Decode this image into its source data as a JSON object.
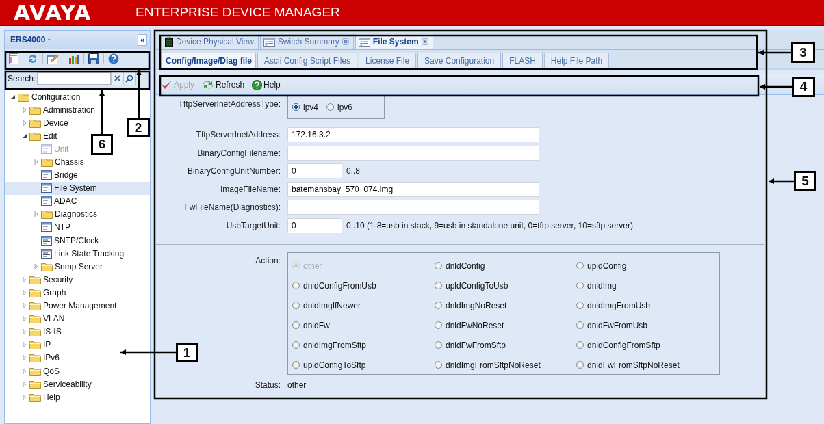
{
  "header": {
    "logo": "AVAYA",
    "title": "ENTERPRISE DEVICE MANAGER"
  },
  "sidebar": {
    "title": "ERS4000 -",
    "collapse": "«",
    "tools": [
      {
        "kind": "form"
      },
      {
        "kind": "refresh"
      },
      {
        "kind": "edit"
      },
      {
        "kind": "chart"
      },
      {
        "kind": "save"
      },
      {
        "kind": "help"
      }
    ],
    "search": {
      "label": "Search:"
    },
    "tree": [
      {
        "label": "Configuration",
        "kind": "folder",
        "expanded": true,
        "selected": false,
        "disabled": false,
        "children": [
          {
            "label": "Administration",
            "kind": "folder",
            "expanded": false,
            "selected": false,
            "disabled": false
          },
          {
            "label": "Device",
            "kind": "folder",
            "expanded": false,
            "selected": false,
            "disabled": false
          },
          {
            "label": "Edit",
            "kind": "folder",
            "expanded": true,
            "selected": false,
            "disabled": false,
            "children": [
              {
                "label": "Unit",
                "kind": "page",
                "selected": false,
                "disabled": true
              },
              {
                "label": "Chassis",
                "kind": "folder",
                "expanded": false,
                "selected": false,
                "disabled": false
              },
              {
                "label": "Bridge",
                "kind": "page",
                "selected": false,
                "disabled": false
              },
              {
                "label": "File System",
                "kind": "page",
                "selected": true,
                "disabled": false
              },
              {
                "label": "ADAC",
                "kind": "page",
                "selected": false,
                "disabled": false
              },
              {
                "label": "Diagnostics",
                "kind": "folder",
                "expanded": false,
                "selected": false,
                "disabled": false
              },
              {
                "label": "NTP",
                "kind": "page",
                "selected": false,
                "disabled": false
              },
              {
                "label": "SNTP/Clock",
                "kind": "page",
                "selected": false,
                "disabled": false
              },
              {
                "label": "Link State Tracking",
                "kind": "page",
                "selected": false,
                "disabled": false
              },
              {
                "label": "Snmp Server",
                "kind": "folder",
                "expanded": false,
                "selected": false,
                "disabled": false
              }
            ]
          },
          {
            "label": "Security",
            "kind": "folder",
            "expanded": false,
            "selected": false,
            "disabled": false
          },
          {
            "label": "Graph",
            "kind": "folder",
            "expanded": false,
            "selected": false,
            "disabled": false
          },
          {
            "label": "Power Management",
            "kind": "folder",
            "expanded": false,
            "selected": false,
            "disabled": false
          },
          {
            "label": "VLAN",
            "kind": "folder",
            "expanded": false,
            "selected": false,
            "disabled": false
          },
          {
            "label": "IS-IS",
            "kind": "folder",
            "expanded": false,
            "selected": false,
            "disabled": false
          },
          {
            "label": "IP",
            "kind": "folder",
            "expanded": false,
            "selected": false,
            "disabled": false
          },
          {
            "label": "IPv6",
            "kind": "folder",
            "expanded": false,
            "selected": false,
            "disabled": false
          },
          {
            "label": "QoS",
            "kind": "folder",
            "expanded": false,
            "selected": false,
            "disabled": false
          },
          {
            "label": "Serviceability",
            "kind": "folder",
            "expanded": false,
            "selected": false,
            "disabled": false
          },
          {
            "label": "Help",
            "kind": "folder",
            "expanded": false,
            "selected": false,
            "disabled": false
          }
        ]
      }
    ]
  },
  "tabs": [
    {
      "label": "Device Physical View",
      "kind": "device",
      "selected": false,
      "closable": false
    },
    {
      "label": "Switch Summary",
      "kind": "table",
      "selected": false,
      "closable": true
    },
    {
      "label": "File System",
      "kind": "table",
      "selected": true,
      "closable": true
    }
  ],
  "subtabs": [
    {
      "label": "Config/Image/Diag file",
      "selected": true
    },
    {
      "label": "Ascii Config Script Files",
      "selected": false
    },
    {
      "label": "License File",
      "selected": false
    },
    {
      "label": "Save Configuration",
      "selected": false
    },
    {
      "label": "FLASH",
      "selected": false
    },
    {
      "label": "Help File Path",
      "selected": false
    }
  ],
  "toolbar": [
    {
      "label": "Apply",
      "kind": "apply",
      "disabled": true
    },
    {
      "label": "Refresh",
      "kind": "refresh",
      "disabled": false
    },
    {
      "label": "Help",
      "kind": "help",
      "disabled": false
    }
  ],
  "form": [
    {
      "label": "TftpServerInetAddressType:",
      "kind": "radio",
      "options": [
        {
          "label": "ipv4",
          "selected": true
        },
        {
          "label": "ipv6",
          "selected": false
        }
      ]
    },
    {
      "label": "TftpServerInetAddress:",
      "kind": "text",
      "value": "172.16.3.2"
    },
    {
      "label": "BinaryConfigFilename:",
      "kind": "text"
    },
    {
      "label": "BinaryConfigUnitNumber:",
      "kind": "number",
      "value": "0",
      "hint": "0..8"
    },
    {
      "label": "ImageFileName:",
      "kind": "text",
      "value": "batemansbay_570_074.img"
    },
    {
      "label": "FwFileName(Diagnostics):",
      "kind": "text"
    },
    {
      "label": "UsbTargetUnit:",
      "kind": "number",
      "value": "0",
      "hint": "0..10 (1-8=usb in stack, 9=usb in standalone unit, 0=tftp server, 10=sftp server)"
    }
  ],
  "action": {
    "label": "Action:",
    "options": [
      {
        "label": "other",
        "selected": true,
        "disabled": true
      },
      {
        "label": "dnldConfig",
        "selected": false,
        "disabled": false
      },
      {
        "label": "upldConfig",
        "selected": false,
        "disabled": false
      },
      {
        "label": "dnldConfigFromUsb",
        "selected": false,
        "disabled": false
      },
      {
        "label": "upldConfigToUsb",
        "selected": false,
        "disabled": false
      },
      {
        "label": "dnldImg",
        "selected": false,
        "disabled": false
      },
      {
        "label": "dnldImgIfNewer",
        "selected": false,
        "disabled": false
      },
      {
        "label": "dnldImgNoReset",
        "selected": false,
        "disabled": false
      },
      {
        "label": "dnldImgFromUsb",
        "selected": false,
        "disabled": false
      },
      {
        "label": "dnldFw",
        "selected": false,
        "disabled": false
      },
      {
        "label": "dnldFwNoReset",
        "selected": false,
        "disabled": false
      },
      {
        "label": "dnldFwFromUsb",
        "selected": false,
        "disabled": false
      },
      {
        "label": "dnldImgFromSftp",
        "selected": false,
        "disabled": false
      },
      {
        "label": "dnldFwFromSftp",
        "selected": false,
        "disabled": false
      },
      {
        "label": "dnldConfigFromSftp",
        "selected": false,
        "disabled": false
      },
      {
        "label": "upldConfigToSftp",
        "selected": false,
        "disabled": false
      },
      {
        "label": "dnldImgFromSftpNoReset",
        "selected": false,
        "disabled": false
      },
      {
        "label": "dnldFwFromSftpNoReset",
        "selected": false,
        "disabled": false
      }
    ]
  },
  "status": {
    "label": "Status:",
    "value": "other"
  },
  "callouts": [
    {
      "label": "1"
    },
    {
      "label": "2"
    },
    {
      "label": "3"
    },
    {
      "label": "4"
    },
    {
      "label": "5"
    },
    {
      "label": "6"
    }
  ]
}
